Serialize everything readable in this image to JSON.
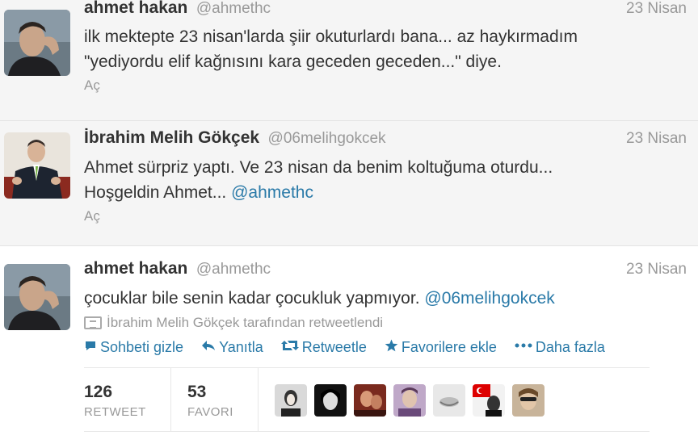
{
  "tweets": [
    {
      "name": "ahmet hakan",
      "handle": "@ahmethc",
      "date": "23 Nisan",
      "text_line1": "ilk mektepte 23 nisan'larda şiir okuturlardı bana... az haykırmadım",
      "text_line2": "\"yediyordu elif kağnısını kara geceden geceden...\" diye.",
      "open_label": "Aç"
    },
    {
      "name": "İbrahim Melih Gökçek",
      "handle": "@06melihgokcek",
      "date": "23 Nisan",
      "text_line1": "Ahmet sürpriz yaptı. Ve 23 nisan da benim koltuğuma oturdu...",
      "text_line2_prefix": "Hoşgeldin Ahmet... ",
      "text_line2_mention": "@ahmethc",
      "open_label": "Aç"
    },
    {
      "name": "ahmet hakan",
      "handle": "@ahmethc",
      "date": "23 Nisan",
      "text_prefix": "çocuklar bile senin kadar çocukluk yapmıyor. ",
      "text_mention": "@06melihgokcek",
      "retweeted_by": "İbrahim Melih Gökçek tarafından retweetlendi",
      "actions": {
        "hide": "Sohbeti gizle",
        "reply": "Yanıtla",
        "retweet": "Retweetle",
        "favorite": "Favorilere ekle",
        "more": "Daha fazla"
      },
      "stats": {
        "retweet_count": "126",
        "retweet_label": "RETWEET",
        "favorite_count": "53",
        "favorite_label": "FAVORI"
      }
    }
  ],
  "colors": {
    "link": "#2a7aa8",
    "muted": "#999999",
    "background_expanded": "#f5f5f5"
  },
  "icons": {
    "hide": "speech-bubble-icon",
    "reply": "reply-arrow-icon",
    "retweet": "retweet-icon",
    "favorite": "star-icon",
    "more": "dots-icon"
  }
}
